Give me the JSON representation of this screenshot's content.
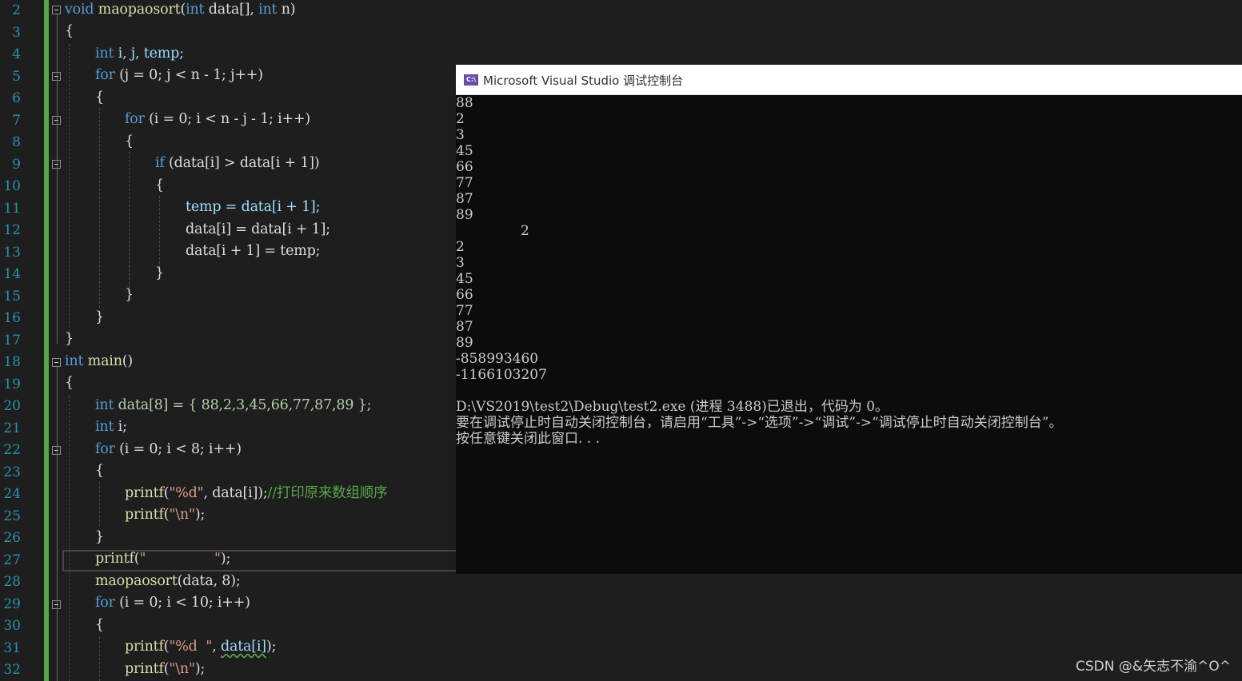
{
  "editor": {
    "line_numbers": [
      "2",
      "3",
      "4",
      "5",
      "6",
      "7",
      "8",
      "9",
      "10",
      "11",
      "12",
      "13",
      "14",
      "15",
      "16",
      "17",
      "18",
      "19",
      "20",
      "21",
      "22",
      "23",
      "24",
      "25",
      "26",
      "27",
      "28",
      "29",
      "30",
      "31",
      "32"
    ],
    "colors": {
      "keyword": "#569cd6",
      "function": "#dcdcaa",
      "variable": "#9cdcfe",
      "number": "#b5cea8",
      "string": "#d69d85",
      "comment": "#57a64a"
    },
    "code": {
      "l2": {
        "kw1": "void",
        "fn": "maopaosort",
        "p1": "(",
        "kw2": "int",
        "v1": " data[], ",
        "kw3": "int",
        "v2": " n)"
      },
      "l3": "{",
      "l4": {
        "kw": "int",
        "rest": " i, j, temp;"
      },
      "l5": {
        "kw": "for",
        "rest": " (j = 0; j < n - 1; j++)"
      },
      "l6": "{",
      "l7": {
        "kw": "for",
        "rest": " (i = 0; i < n - j - 1; i++)"
      },
      "l8": "{",
      "l9": {
        "kw": "if",
        "rest": " (data[i] > data[i + 1])"
      },
      "l10": "{",
      "l11": "temp = data[i + 1];",
      "l12": "data[i] = data[i + 1];",
      "l13": "data[i + 1] = temp;",
      "l14": "}",
      "l15": "}",
      "l16": "}",
      "l17": "}",
      "l18": {
        "kw": "int",
        "fn": " main",
        "rest": "()"
      },
      "l19": "{",
      "l20": {
        "kw": "int",
        "rest": " data[8] = { 88,2,3,45,66,77,87,89 };"
      },
      "l21": {
        "kw": "int",
        "rest": " i;"
      },
      "l22": {
        "kw": "for",
        "rest": " (i = 0; i < 8; i++)"
      },
      "l23": "{",
      "l24": {
        "fn": "printf",
        "p1": "(",
        "str": "\"%d\"",
        "p2": ", data[i]);",
        "cmt": "//打印原来数组顺序"
      },
      "l25": {
        "fn": "printf",
        "p1": "(",
        "str": "\"\\n\"",
        "p2": ");"
      },
      "l26": "}",
      "l27": {
        "fn": "printf",
        "p1": "(",
        "str": "\"                \"",
        "p2": ");"
      },
      "l28": {
        "fn": "maopaosort",
        "rest": "(data, 8);"
      },
      "l29": {
        "kw": "for",
        "rest": " (i = 0; i < 10; i++)"
      },
      "l30": "{",
      "l31": {
        "fn": "printf",
        "p1": "(",
        "str": "\"%d  \"",
        "p2": ", ",
        "sq": "data[i]",
        "p3": ");"
      },
      "l32": {
        "fn": "printf",
        "p1": "(",
        "str": "\"\\n\"",
        "p2": ");"
      }
    }
  },
  "console": {
    "title": "Microsoft Visual Studio 调试控制台",
    "icon_text": "C:\\",
    "lines": [
      "88",
      "2",
      "3",
      "45",
      "66",
      "77",
      "87",
      "89",
      "               2",
      "2",
      "3",
      "45",
      "66",
      "77",
      "87",
      "89",
      "-858993460",
      "-1166103207",
      "",
      "D:\\VS2019\\test2\\Debug\\test2.exe (进程 3488)已退出，代码为 0。",
      "要在调试停止时自动关闭控制台，请启用“工具”->“选项”->“调试”->“调试停止时自动关闭控制台”。",
      "按任意键关闭此窗口. . ."
    ]
  },
  "watermark": "CSDN @&矢志不渝^O^"
}
